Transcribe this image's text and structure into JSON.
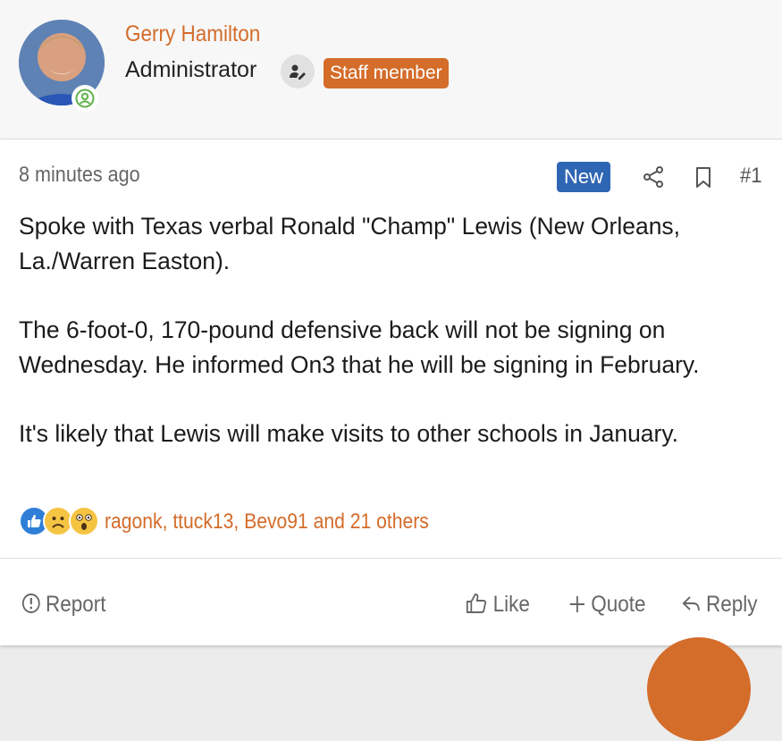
{
  "user": {
    "name": "Gerry Hamilton",
    "title": "Administrator",
    "staff_badge": "Staff member",
    "avatar_icon": "avatar",
    "online_icon": "online-user-icon",
    "user_icon": "user-edit-icon"
  },
  "post": {
    "time": "8 minutes ago",
    "new_badge": "New",
    "number": "#1",
    "paragraphs": [
      "Spoke with Texas verbal Ronald \"Champ\" Lewis (New Orleans, La./Warren Easton).",
      "The 6-foot-0, 170-pound defensive back will not be signing on Wednesday. He informed On3 that he will be signing in February.",
      "It's likely that Lewis will make visits to other schools in January."
    ],
    "reaction_users": "ragonk, ttuck13, Bevo91 and 21 others",
    "reaction_icons": [
      "like-reaction-icon",
      "sad-reaction-icon",
      "wow-reaction-icon"
    ]
  },
  "actions": {
    "report": "Report",
    "like": "Like",
    "quote": "Quote",
    "reply": "Reply"
  },
  "colors": {
    "accent": "#d46c2a",
    "new_badge": "#2f66b3"
  }
}
